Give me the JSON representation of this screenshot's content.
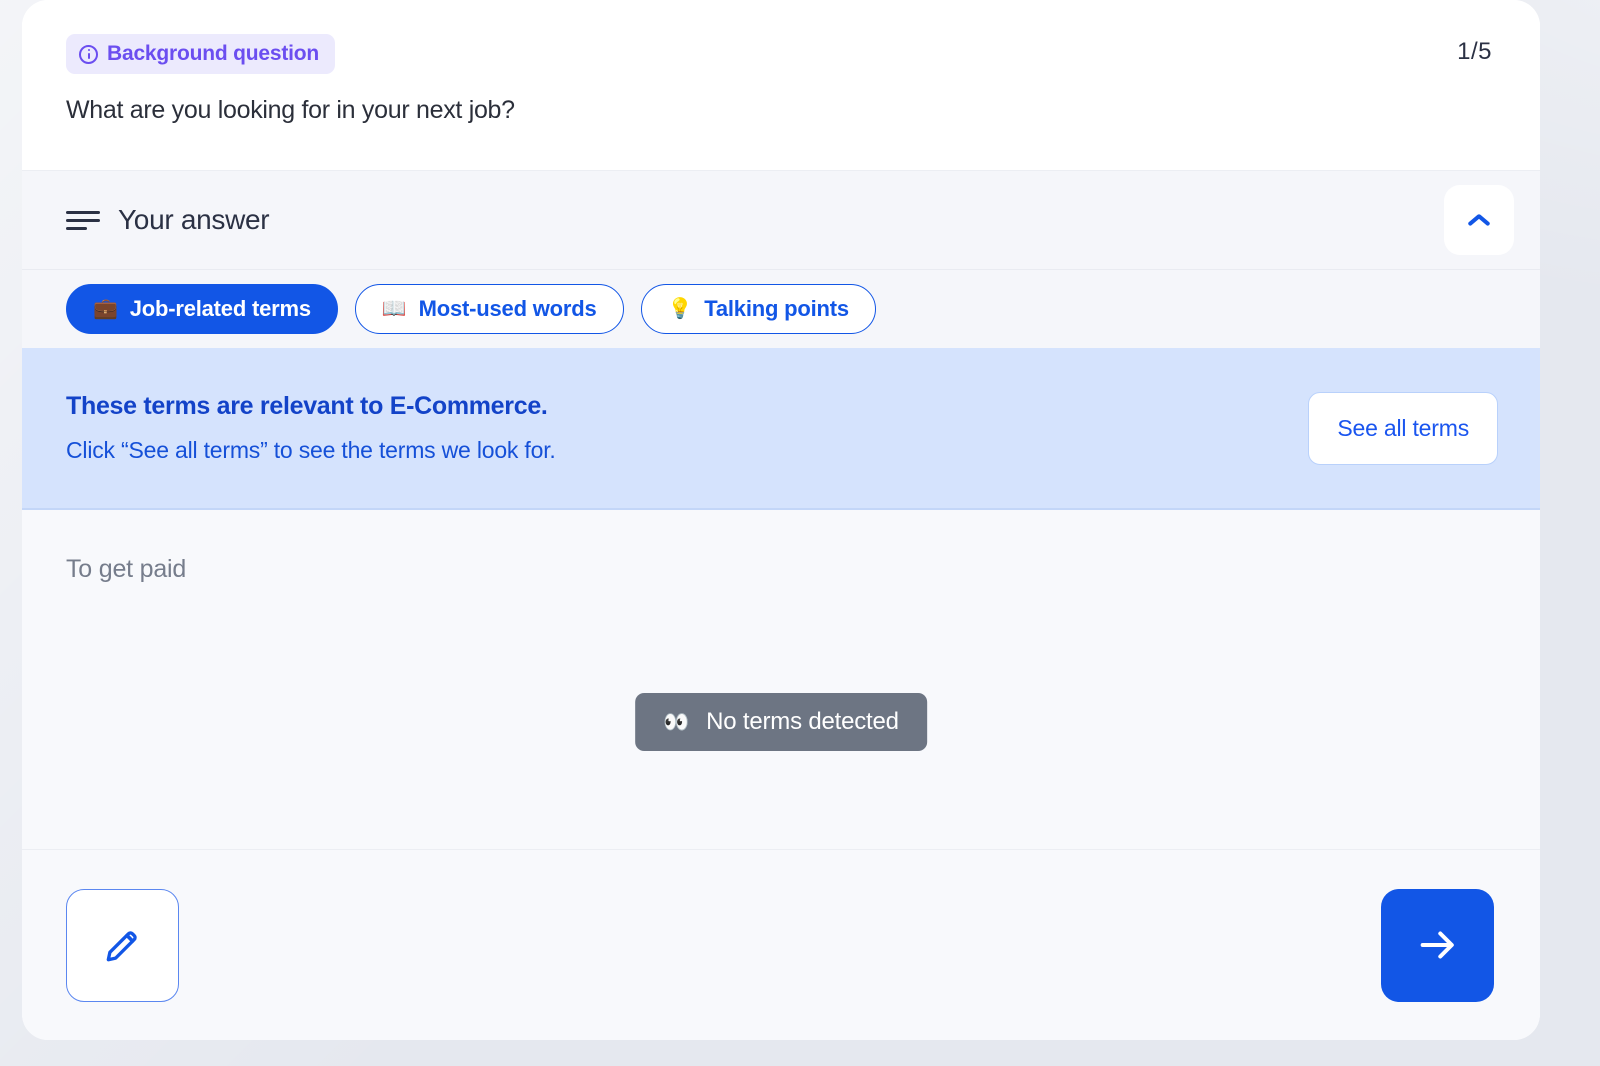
{
  "question_header": {
    "badge_label": "Background question",
    "badge_icon": "info-circle-icon",
    "question_text": "What are you looking for in your next job?",
    "page_counter": "1/5"
  },
  "answer_section": {
    "icon": "notes-lines-icon",
    "title": "Your answer",
    "collapse_icon": "chevron-up-icon"
  },
  "tabs": [
    {
      "label": "Job-related terms",
      "emoji": "💼",
      "icon": "briefcase-icon",
      "active": true
    },
    {
      "label": "Most-used words",
      "emoji": "📖",
      "icon": "open-book-icon",
      "active": false
    },
    {
      "label": "Talking points",
      "emoji": "💡",
      "icon": "lightbulb-icon",
      "active": false
    }
  ],
  "info_banner": {
    "title": "These terms are relevant to E-Commerce.",
    "subtitle": "Click “See all terms” to see the terms we look for.",
    "button_label": "See all terms"
  },
  "transcript": {
    "text": "To get paid",
    "empty_chip_label": "No terms detected",
    "empty_chip_emoji": "👀"
  },
  "toolbar": {
    "edit_icon": "pencil-icon",
    "next_icon": "arrow-right-icon"
  },
  "colors": {
    "accent_blue": "#1256e6",
    "badge_purple": "#6b4ef0",
    "badge_bg": "#eceafd",
    "banner_bg": "#d5e3fd",
    "banner_title": "#1343c8",
    "chip_gray": "#6d7583",
    "page_bg": "#e5e8ef",
    "card_bg": "#ffffff",
    "section_bg": "#f5f6fa"
  }
}
